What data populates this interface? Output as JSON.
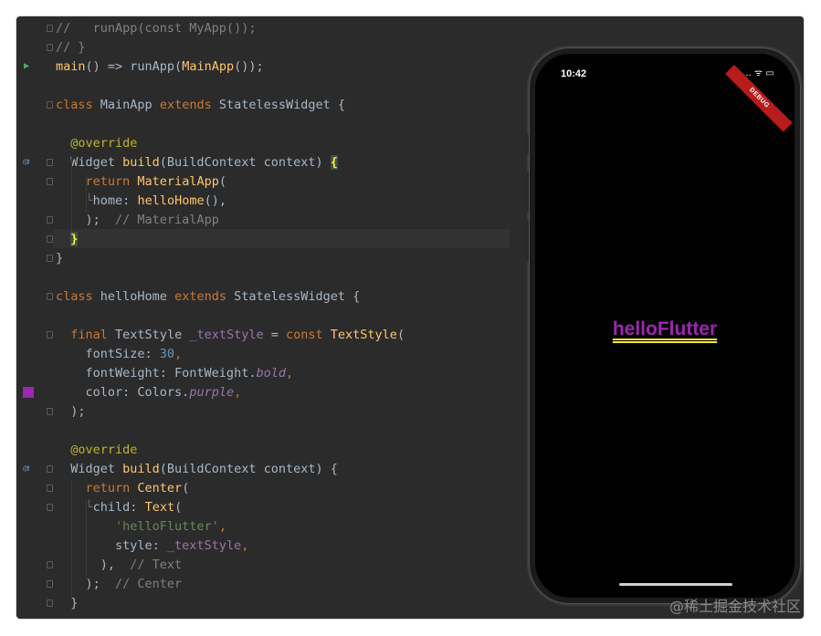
{
  "code_lines": [
    [
      {
        "t": "//   runApp(const MyApp());",
        "c": "cm"
      }
    ],
    [
      {
        "t": "// }",
        "c": "cm"
      }
    ],
    [
      {
        "t": "main",
        "c": "fn"
      },
      {
        "t": "() => runApp(",
        "c": "plain"
      },
      {
        "t": "MainApp",
        "c": "fn"
      },
      {
        "t": "());",
        "c": "plain"
      }
    ],
    [
      {
        "t": "",
        "c": "plain"
      }
    ],
    [
      {
        "t": "class ",
        "c": "kw"
      },
      {
        "t": "MainApp ",
        "c": "cls"
      },
      {
        "t": "extends ",
        "c": "kw"
      },
      {
        "t": "StatelessWidget {",
        "c": "plain"
      }
    ],
    [
      {
        "t": "",
        "c": "plain"
      }
    ],
    [
      {
        "t": "  ",
        "c": "plain"
      },
      {
        "t": "@override",
        "c": "ann"
      }
    ],
    [
      {
        "t": "  Widget ",
        "c": "plain"
      },
      {
        "t": "build",
        "c": "fn"
      },
      {
        "t": "(BuildContext context) ",
        "c": "plain"
      },
      {
        "t": "{",
        "c": "brace"
      }
    ],
    [
      {
        "t": "    ",
        "c": "plain"
      },
      {
        "t": "return ",
        "c": "kw"
      },
      {
        "t": "MaterialApp",
        "c": "fn"
      },
      {
        "t": "(",
        "c": "plain"
      }
    ],
    [
      {
        "t": "    ",
        "c": "plain"
      },
      {
        "t": "└",
        "c": "tree"
      },
      {
        "t": "home: ",
        "c": "plain"
      },
      {
        "t": "helloHome",
        "c": "fn"
      },
      {
        "t": "(),",
        "c": "plain"
      }
    ],
    [
      {
        "t": "    );  ",
        "c": "plain"
      },
      {
        "t": "// MaterialApp",
        "c": "cm"
      }
    ],
    [
      {
        "t": "  ",
        "c": "plain"
      },
      {
        "t": "}",
        "c": "brace"
      }
    ],
    [
      {
        "t": "}",
        "c": "plain"
      }
    ],
    [
      {
        "t": "",
        "c": "plain"
      }
    ],
    [
      {
        "t": "class ",
        "c": "kw"
      },
      {
        "t": "helloHome ",
        "c": "cls"
      },
      {
        "t": "extends ",
        "c": "kw"
      },
      {
        "t": "StatelessWidget {",
        "c": "plain"
      }
    ],
    [
      {
        "t": "",
        "c": "plain"
      }
    ],
    [
      {
        "t": "  ",
        "c": "plain"
      },
      {
        "t": "final ",
        "c": "kw"
      },
      {
        "t": "TextStyle ",
        "c": "plain"
      },
      {
        "t": "_textStyle ",
        "c": "field"
      },
      {
        "t": "= ",
        "c": "plain"
      },
      {
        "t": "const ",
        "c": "kw"
      },
      {
        "t": "TextStyle",
        "c": "fn"
      },
      {
        "t": "(",
        "c": "plain"
      }
    ],
    [
      {
        "t": "    fontSize: ",
        "c": "plain"
      },
      {
        "t": "30",
        "c": "num"
      },
      {
        "t": ",",
        "c": "kw"
      }
    ],
    [
      {
        "t": "    fontWeight: FontWeight.",
        "c": "plain"
      },
      {
        "t": "bold",
        "c": "prop"
      },
      {
        "t": ",",
        "c": "kw"
      }
    ],
    [
      {
        "t": "    color: Colors.",
        "c": "plain"
      },
      {
        "t": "purple",
        "c": "prop"
      },
      {
        "t": ",",
        "c": "kw"
      }
    ],
    [
      {
        "t": "  );",
        "c": "plain"
      }
    ],
    [
      {
        "t": "",
        "c": "plain"
      }
    ],
    [
      {
        "t": "  ",
        "c": "plain"
      },
      {
        "t": "@override",
        "c": "ann"
      }
    ],
    [
      {
        "t": "  Widget ",
        "c": "plain"
      },
      {
        "t": "build",
        "c": "fn"
      },
      {
        "t": "(BuildContext context) {",
        "c": "plain"
      }
    ],
    [
      {
        "t": "    ",
        "c": "plain"
      },
      {
        "t": "return ",
        "c": "kw"
      },
      {
        "t": "Center",
        "c": "fn"
      },
      {
        "t": "(",
        "c": "plain"
      }
    ],
    [
      {
        "t": "    ",
        "c": "plain"
      },
      {
        "t": "└",
        "c": "tree"
      },
      {
        "t": "child: ",
        "c": "plain"
      },
      {
        "t": "Text",
        "c": "fn"
      },
      {
        "t": "(",
        "c": "plain"
      }
    ],
    [
      {
        "t": "        ",
        "c": "plain"
      },
      {
        "t": "'helloFlutter'",
        "c": "str"
      },
      {
        "t": ",",
        "c": "kw"
      }
    ],
    [
      {
        "t": "        style: ",
        "c": "plain"
      },
      {
        "t": "_textStyle",
        "c": "field"
      },
      {
        "t": ",",
        "c": "kw"
      }
    ],
    [
      {
        "t": "      ),  ",
        "c": "plain"
      },
      {
        "t": "// Text",
        "c": "cm"
      }
    ],
    [
      {
        "t": "    );  ",
        "c": "plain"
      },
      {
        "t": "// Center",
        "c": "cm"
      }
    ],
    [
      {
        "t": "  }",
        "c": "plain"
      }
    ]
  ],
  "gutter": [
    {
      "line": 2,
      "mark": "run",
      "icon": "run-icon"
    },
    {
      "line": 7,
      "mark": "override",
      "icon": "override-icon"
    },
    {
      "line": 19,
      "mark": "color",
      "icon": "purple-color-swatch-icon",
      "color": "#9c27b0"
    },
    {
      "line": 23,
      "mark": "override",
      "icon": "override-icon"
    }
  ],
  "fold_lines": [
    0,
    1,
    4,
    7,
    8,
    10,
    11,
    12,
    14,
    16,
    20,
    23,
    24,
    25,
    28,
    29,
    30
  ],
  "phone": {
    "time": "10:42",
    "status_icons": ".... ᯤ ▭",
    "debug_banner": "DEBUG",
    "hello_text": "helloFlutter",
    "text_color": "#9c27b0",
    "underline_color": "#ffeb3b"
  },
  "watermark": "@稀土掘金技术社区"
}
